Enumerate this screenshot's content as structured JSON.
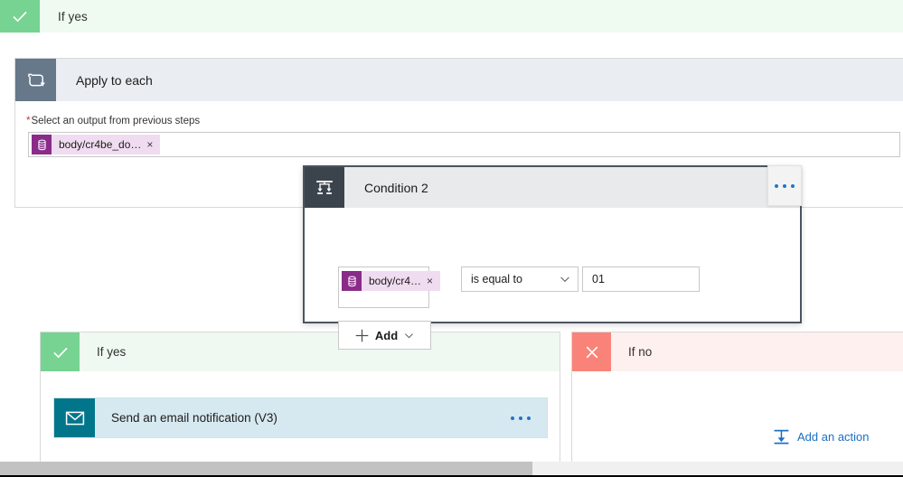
{
  "top_branch": {
    "label": "If yes",
    "icon": "check-icon",
    "bar_color": "#effaf1",
    "icon_color": "#76d391"
  },
  "apply_to_each": {
    "title": "Apply to each",
    "icon": "loop-icon",
    "header_color": "#eaeef2",
    "icon_color": "#66788a",
    "field": {
      "label": "Select an output from previous steps",
      "required_marker": "*",
      "token": {
        "text": "body/cr4be_do…",
        "remove_label": "×",
        "icon": "database-icon",
        "icon_color": "#8a2b8a",
        "chip_color": "#f0dcf0"
      }
    }
  },
  "condition": {
    "title": "Condition 2",
    "icon": "condition-branch-icon",
    "header_color": "#e9eaeb",
    "icon_color": "#3b444d",
    "border_color": "#4a5560",
    "menu_label": "•••",
    "menu_icon": "ellipsis-icon",
    "row": {
      "operand_token": {
        "text": "body/cr4…",
        "remove_label": "×",
        "icon": "database-icon"
      },
      "operator": "is equal to",
      "operator_icon": "chevron-down-icon",
      "value": "01"
    },
    "add_button": {
      "label": "Add",
      "plus_icon": "plus-icon",
      "chevron_icon": "chevron-down-icon"
    }
  },
  "yes_branch": {
    "label": "If yes",
    "icon": "check-icon",
    "header_color": "#eff8f1",
    "icon_color": "#76d391",
    "action": {
      "title": "Send an email notification (V3)",
      "icon": "envelope-icon",
      "icon_color": "#01768b",
      "card_color": "#d7e9f0",
      "menu_icon": "ellipsis-icon",
      "menu_label": "•••"
    }
  },
  "no_branch": {
    "label": "If no",
    "icon": "close-x-icon",
    "header_color": "#fdf0ef",
    "icon_color": "#f98378",
    "add_action": {
      "label": "Add an action",
      "icon": "insert-action-icon",
      "link_color": "#1b6ec2"
    }
  },
  "scrollbar": {
    "orientation": "horizontal",
    "track_color": "#f0f0f0",
    "thumb_color": "#c2c2c2"
  }
}
